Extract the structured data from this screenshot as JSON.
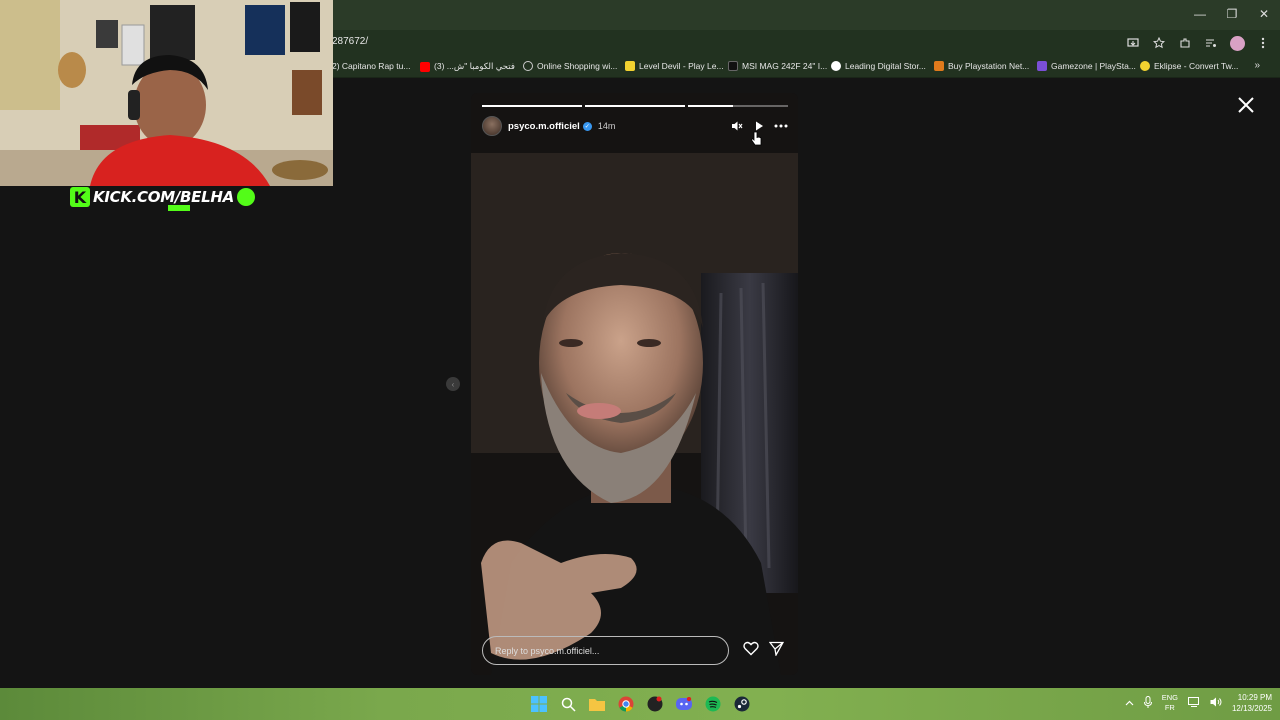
{
  "browser": {
    "url": "287672/",
    "window_controls": {
      "minimize": "—",
      "restore": "❐",
      "close": "✕"
    },
    "bookmarks": [
      {
        "label": "2) Capitano Rap tu...",
        "icon": "",
        "color": "#888888"
      },
      {
        "label": "فتحي الكومبا \"ش... (3)",
        "icon": "youtube-icon",
        "color": "#ff0000"
      },
      {
        "label": "Online Shopping wi...",
        "icon": "globe-icon",
        "color": "#cccccc"
      },
      {
        "label": "Level Devil - Play Le...",
        "icon": "game-icon",
        "color": "#f2d230"
      },
      {
        "label": "MSI MAG 242F 24\" I...",
        "icon": "x-icon",
        "color": "#111111"
      },
      {
        "label": "Leading Digital Stor...",
        "icon": "store-icon",
        "color": "#ffffff"
      },
      {
        "label": "Buy Playstation Net...",
        "icon": "tag-icon",
        "color": "#e07a1c"
      },
      {
        "label": "Gamezone | PlaySta...",
        "icon": "gamezone-icon",
        "color": "#7a4fd6"
      },
      {
        "label": "Eklipse - Convert Tw...",
        "icon": "eklipse-icon",
        "color": "#f2d230"
      }
    ]
  },
  "story": {
    "username": "psyco.m.officiel",
    "time": "14m",
    "progress": [
      1,
      1,
      0.45
    ],
    "reply_placeholder": "Reply to psyco.m.officiel..."
  },
  "overlay": {
    "channel": "KICK.COM/BELHA",
    "k": "K"
  },
  "taskbar": {
    "lang_top": "ENG",
    "lang_bottom": "FR",
    "time": "10:29 PM",
    "date": "12/13/2025"
  }
}
